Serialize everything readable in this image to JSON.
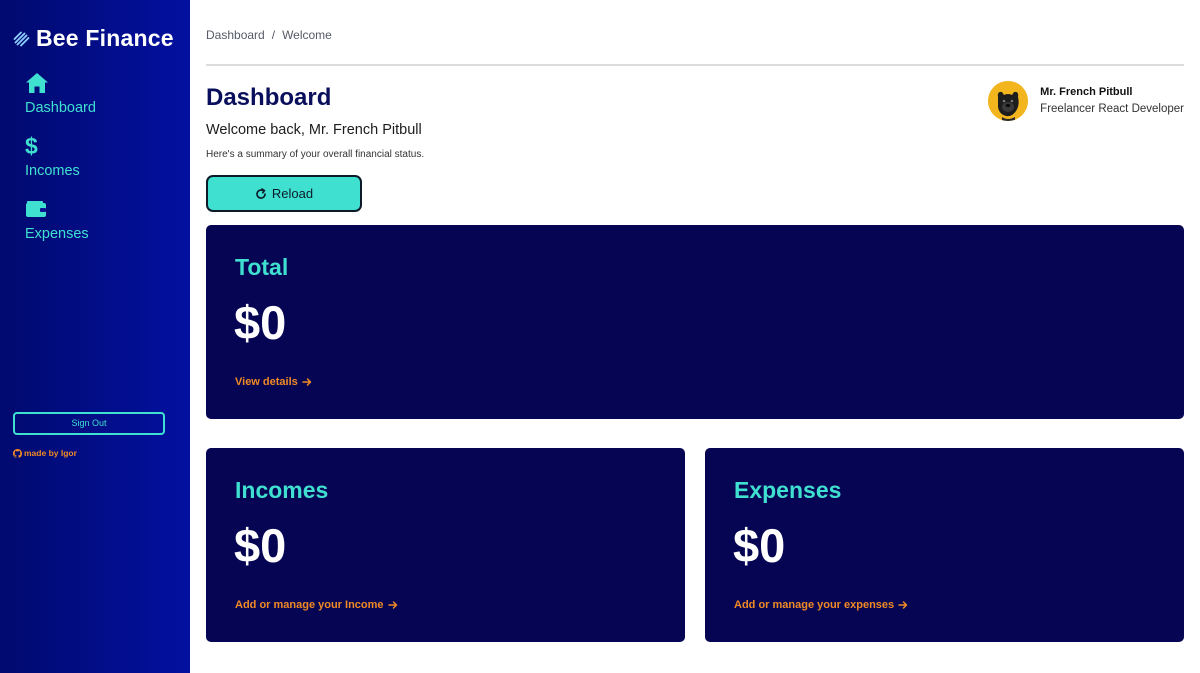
{
  "app": {
    "brand": "Bee Finance"
  },
  "sidebar": {
    "items": [
      {
        "label": "Dashboard",
        "icon": "home-icon"
      },
      {
        "label": "Incomes",
        "icon": "dollar-icon"
      },
      {
        "label": "Expenses",
        "icon": "wallet-icon"
      }
    ],
    "signout_label": "Sign Out",
    "madeby_label": "made by Igor"
  },
  "header": {
    "breadcrumb": [
      "Dashboard",
      "Welcome"
    ],
    "breadcrumb_sep": "/"
  },
  "main": {
    "title": "Dashboard",
    "welcome": "Welcome back, Mr. French Pitbull",
    "summary": "Here's a summary of your overall financial status.",
    "reload_label": "Reload"
  },
  "profile": {
    "name": "Mr. French Pitbull",
    "role": "Freelancer React Developer"
  },
  "cards": {
    "total": {
      "title": "Total",
      "value": "$0",
      "link": "View details"
    },
    "incomes": {
      "title": "Incomes",
      "value": "$0",
      "link": "Add or manage your Income"
    },
    "expenses": {
      "title": "Expenses",
      "value": "$0",
      "link": "Add or manage your expenses"
    }
  },
  "colors": {
    "sidebar_bg": "#0210a0",
    "accent": "#40e0d0",
    "card_bg": "#050554",
    "link": "#f08a24",
    "title": "#0a0f5c"
  }
}
